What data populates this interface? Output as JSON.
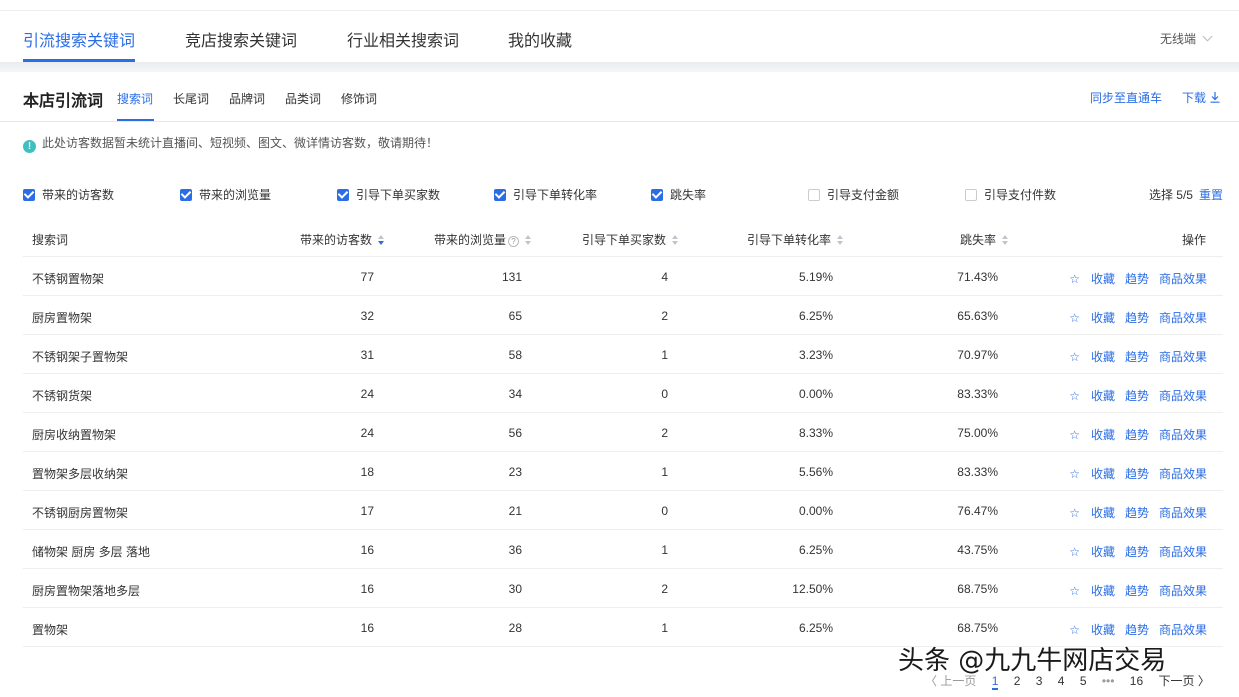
{
  "top_tabs": [
    {
      "label": "引流搜索关键词",
      "active": true
    },
    {
      "label": "竞店搜索关键词",
      "active": false
    },
    {
      "label": "行业相关搜索词",
      "active": false
    },
    {
      "label": "我的收藏",
      "active": false
    }
  ],
  "device_selector": "无线端",
  "section": {
    "title": "本店引流词",
    "subtabs": [
      "搜索词",
      "长尾词",
      "品牌词",
      "品类词",
      "修饰词"
    ],
    "sync_link": "同步至直通车",
    "download_link": "下载"
  },
  "notice": "此处访客数据暂未统计直播间、短视频、图文、微详情访客数，敬请期待！",
  "filters": [
    {
      "label": "带来的访客数",
      "checked": true
    },
    {
      "label": "带来的浏览量",
      "checked": true
    },
    {
      "label": "引导下单买家数",
      "checked": true
    },
    {
      "label": "引导下单转化率",
      "checked": true
    },
    {
      "label": "跳失率",
      "checked": true
    },
    {
      "label": "引导支付金额",
      "checked": false
    },
    {
      "label": "引导支付件数",
      "checked": false
    }
  ],
  "selection": {
    "text": "选择 5/5",
    "reset": "重置"
  },
  "table": {
    "headers": {
      "keyword": "搜索词",
      "visitors": "带来的访客数",
      "pageviews": "带来的浏览量",
      "buyers": "引导下单买家数",
      "conversion": "引导下单转化率",
      "bounce": "跳失率",
      "ops": "操作"
    },
    "ops_labels": {
      "favorite": "收藏",
      "trend": "趋势",
      "effect": "商品效果"
    },
    "rows": [
      {
        "keyword": "不锈钢置物架",
        "visitors": "77",
        "pageviews": "131",
        "buyers": "4",
        "conversion": "5.19%",
        "bounce": "71.43%"
      },
      {
        "keyword": "厨房置物架",
        "visitors": "32",
        "pageviews": "65",
        "buyers": "2",
        "conversion": "6.25%",
        "bounce": "65.63%"
      },
      {
        "keyword": "不锈钢架子置物架",
        "visitors": "31",
        "pageviews": "58",
        "buyers": "1",
        "conversion": "3.23%",
        "bounce": "70.97%"
      },
      {
        "keyword": "不锈钢货架",
        "visitors": "24",
        "pageviews": "34",
        "buyers": "0",
        "conversion": "0.00%",
        "bounce": "83.33%"
      },
      {
        "keyword": "厨房收纳置物架",
        "visitors": "24",
        "pageviews": "56",
        "buyers": "2",
        "conversion": "8.33%",
        "bounce": "75.00%"
      },
      {
        "keyword": "置物架多层收纳架",
        "visitors": "18",
        "pageviews": "23",
        "buyers": "1",
        "conversion": "5.56%",
        "bounce": "83.33%"
      },
      {
        "keyword": "不锈钢厨房置物架",
        "visitors": "17",
        "pageviews": "21",
        "buyers": "0",
        "conversion": "0.00%",
        "bounce": "76.47%"
      },
      {
        "keyword": "储物架 厨房 多层 落地",
        "visitors": "16",
        "pageviews": "36",
        "buyers": "1",
        "conversion": "6.25%",
        "bounce": "43.75%"
      },
      {
        "keyword": "厨房置物架落地多层",
        "visitors": "16",
        "pageviews": "30",
        "buyers": "2",
        "conversion": "12.50%",
        "bounce": "68.75%"
      },
      {
        "keyword": "置物架",
        "visitors": "16",
        "pageviews": "28",
        "buyers": "1",
        "conversion": "6.25%",
        "bounce": "68.75%"
      }
    ]
  },
  "pagination": {
    "prev": "〈 上一页",
    "pages": [
      "1",
      "2",
      "3",
      "4",
      "5",
      "•••",
      "16"
    ],
    "next": "下一页 〉"
  },
  "watermark": "头条 @九九牛网店交易"
}
